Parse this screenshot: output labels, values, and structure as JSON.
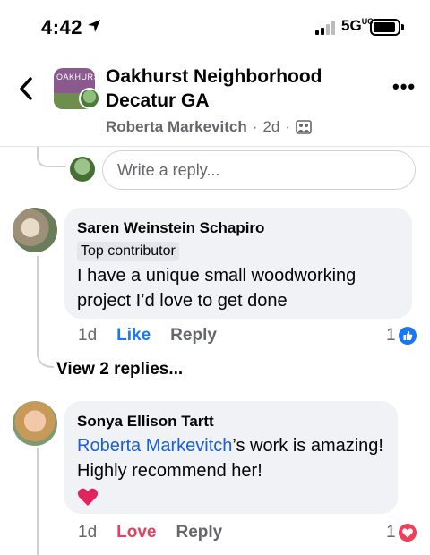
{
  "status": {
    "time": "4:42",
    "network": "5G",
    "network_suffix": "UC"
  },
  "header": {
    "group_avatar_text": "OAKHURST",
    "title": "Oakhurst Neighborhood Decatur GA",
    "author": "Roberta Markevitch",
    "age": "2d",
    "separator": "·"
  },
  "reply": {
    "placeholder": "Write a reply..."
  },
  "comments": [
    {
      "author": "Saren Weinstein Schapiro",
      "badge": "Top contributor",
      "text": "I have a unique small woodworking project I’d love to get done",
      "age": "1d",
      "reaction_label": "Like",
      "reply_label": "Reply",
      "reaction_count": "1"
    },
    {
      "author": "Sonya Ellison Tartt",
      "mention": "Roberta Markevitch",
      "text": "’s work is amazing! Highly recommend her!",
      "age": "1d",
      "reaction_label": "Love",
      "reply_label": "Reply",
      "reaction_count": "1"
    }
  ],
  "view_replies": "View 2 replies...",
  "colors": {
    "accent": "#1877f2",
    "love": "#e4405f",
    "bubble": "#f0f2f5",
    "muted": "#65676b"
  }
}
